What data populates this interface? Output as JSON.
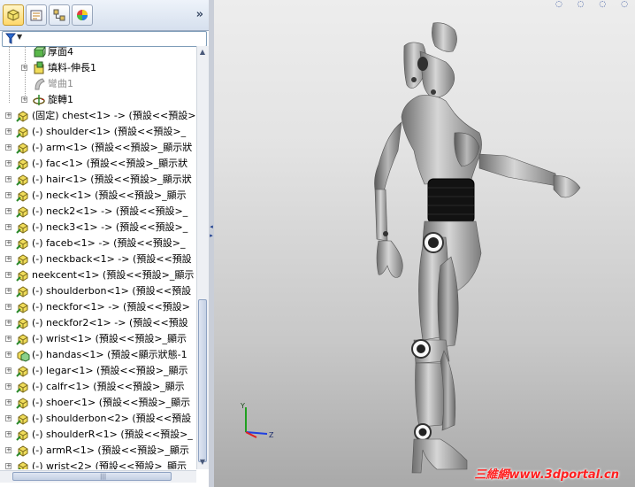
{
  "tabs": [
    {
      "name": "feature-manager",
      "icon": "feature-tree-icon",
      "active": true
    },
    {
      "name": "property-manager",
      "icon": "property-icon"
    },
    {
      "name": "configuration-manager",
      "icon": "configuration-icon"
    },
    {
      "name": "appearance-manager",
      "icon": "appearance-icon"
    }
  ],
  "tabbar": {
    "more": "»"
  },
  "tree": {
    "items": [
      {
        "label": "厚面4",
        "icon": "thicken-feature-icon",
        "indent": 2,
        "expander": false,
        "dim": false
      },
      {
        "label": "填料-伸長1",
        "icon": "boss-extrude-icon",
        "indent": 2,
        "expander": true,
        "dim": false
      },
      {
        "label": "彎曲1",
        "icon": "flex-feature-icon",
        "indent": 2,
        "expander": false,
        "dim": true
      },
      {
        "label": "旋轉1",
        "icon": "revolve-feature-icon",
        "indent": 2,
        "expander": true,
        "dim": false
      },
      {
        "label": "(固定) chest<1> -> (預設<<預設>",
        "icon": "part-icon",
        "indent": 0,
        "expander": true
      },
      {
        "label": "(-) shoulder<1> (預設<<預設>_",
        "icon": "part-icon",
        "indent": 0,
        "expander": true
      },
      {
        "label": "(-) arm<1> (預設<<預設>_顯示狀",
        "icon": "part-icon",
        "indent": 0,
        "expander": true
      },
      {
        "label": "(-) fac<1> (預設<<預設>_顯示狀",
        "icon": "part-icon",
        "indent": 0,
        "expander": true
      },
      {
        "label": "(-) hair<1> (預設<<預設>_顯示狀",
        "icon": "part-icon",
        "indent": 0,
        "expander": true
      },
      {
        "label": "(-) neck<1> (預設<<預設>_顯示",
        "icon": "part-icon",
        "indent": 0,
        "expander": true
      },
      {
        "label": "(-) neck2<1> -> (預設<<預設>_",
        "icon": "part-icon",
        "indent": 0,
        "expander": true
      },
      {
        "label": "(-) neck3<1> -> (預設<<預設>_",
        "icon": "part-icon",
        "indent": 0,
        "expander": true
      },
      {
        "label": "(-) faceb<1> -> (預設<<預設>_",
        "icon": "part-icon",
        "indent": 0,
        "expander": true
      },
      {
        "label": "(-) neckback<1> -> (預設<<預設",
        "icon": "part-icon",
        "indent": 0,
        "expander": true
      },
      {
        "label": "neekcent<1> (預設<<預設>_顯示",
        "icon": "part-icon",
        "indent": 0,
        "expander": true
      },
      {
        "label": "(-) shoulderbon<1> (預設<<預設",
        "icon": "part-icon",
        "indent": 0,
        "expander": true
      },
      {
        "label": "(-) neckfor<1> -> (預設<<預設>",
        "icon": "part-icon",
        "indent": 0,
        "expander": true
      },
      {
        "label": "(-) neckfor2<1> -> (預設<<預設",
        "icon": "part-icon",
        "indent": 0,
        "expander": true
      },
      {
        "label": "(-) wrist<1> (預設<<預設>_顯示",
        "icon": "part-icon",
        "indent": 0,
        "expander": true
      },
      {
        "label": "(-) handas<1> (預設<顯示狀態-1",
        "icon": "assembly-icon",
        "indent": 0,
        "expander": true
      },
      {
        "label": "(-) legar<1> (預設<<預設>_顯示",
        "icon": "part-icon",
        "indent": 0,
        "expander": true
      },
      {
        "label": "(-) calfr<1> (預設<<預設>_顯示",
        "icon": "part-icon",
        "indent": 0,
        "expander": true
      },
      {
        "label": "(-) shoer<1> (預設<<預設>_顯示",
        "icon": "part-icon",
        "indent": 0,
        "expander": true
      },
      {
        "label": "(-) shoulderbon<2> (預設<<預設",
        "icon": "part-icon",
        "indent": 0,
        "expander": true
      },
      {
        "label": "(-) shoulderR<1> (預設<<預設>_",
        "icon": "part-icon",
        "indent": 0,
        "expander": true
      },
      {
        "label": "(-) armR<1> (預設<<預設>_顯示",
        "icon": "part-icon",
        "indent": 0,
        "expander": true
      },
      {
        "label": "(-) wrist<2> (預設<<預設>_顯示",
        "icon": "part-icon",
        "indent": 0,
        "expander": true
      }
    ]
  },
  "triad": {
    "y": "Y",
    "z": "Z"
  },
  "watermark": "三維網www.3dportal.cn",
  "colors": {
    "accent": "#2a4a9a",
    "watermark": "#ff2020",
    "tree_bg": "#ffffff"
  }
}
